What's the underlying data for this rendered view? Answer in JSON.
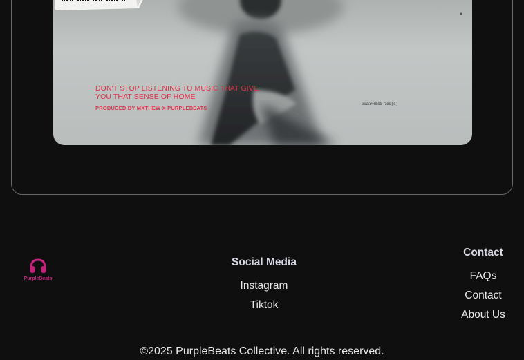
{
  "hero": {
    "tagline": "DON'T STOP LISTENING TO MUSIC THAT GIVE YOU THAT SENSE OF HOME",
    "credit": "PRODUCED BY MXTHEW X PURPLEBEATS",
    "barcode_number": "0123A456B-789(C)",
    "accent_color": "#e0314a"
  },
  "footer": {
    "logo": {
      "icon": "headphones-icon",
      "text": "PurpleBeats",
      "color": "#c4237c"
    },
    "social": {
      "heading": "Social Media",
      "links": [
        "Instagram",
        "Tiktok"
      ]
    },
    "contact": {
      "heading": "Contact",
      "links": [
        "FAQs",
        "Contact",
        "About Us"
      ]
    },
    "copyright": "©2025 PurpleBeats Collective. All rights reserved."
  }
}
